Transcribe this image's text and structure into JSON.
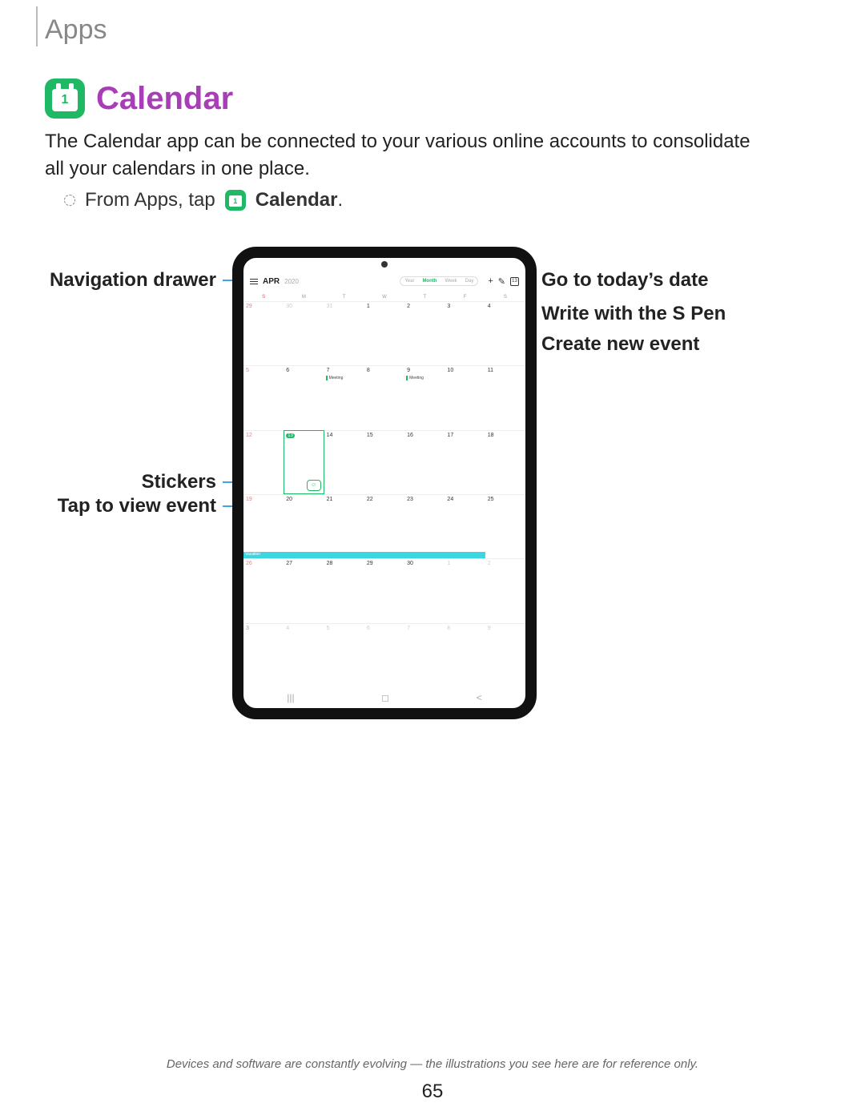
{
  "section": "Apps",
  "title": "Calendar",
  "icon_number": "1",
  "intro": "The Calendar app can be connected to your various online accounts to consolidate all your calendars in one place.",
  "step_prefix": "From Apps, tap",
  "step_app": "Calendar",
  "step_period": ".",
  "callouts": {
    "nav_drawer": "Navigation drawer",
    "today": "Go to today’s date",
    "spen": "Write with the S Pen",
    "new_event": "Create new event",
    "stickers": "Stickers",
    "tap_view": "Tap to view event"
  },
  "calendar": {
    "month": "APR",
    "year": "2020",
    "views": [
      "Year",
      "Month",
      "Week",
      "Day"
    ],
    "active_view": "Month",
    "today_box": "13",
    "dow": [
      "S",
      "M",
      "T",
      "W",
      "T",
      "F",
      "S"
    ],
    "rows": [
      [
        "29",
        "30",
        "31",
        "1",
        "2",
        "3",
        "4"
      ],
      [
        "5",
        "6",
        "7",
        "8",
        "9",
        "10",
        "11"
      ],
      [
        "12",
        "13",
        "14",
        "15",
        "16",
        "17",
        "18"
      ],
      [
        "19",
        "20",
        "21",
        "22",
        "23",
        "24",
        "25"
      ],
      [
        "26",
        "27",
        "28",
        "29",
        "30",
        "1",
        "2"
      ],
      [
        "3",
        "4",
        "5",
        "6",
        "7",
        "8",
        "9"
      ]
    ],
    "meeting_label": "Meeting",
    "event_label": "Vacation",
    "today_day": "13"
  },
  "footnote": "Devices and software are constantly evolving — the illustrations you see here are for reference only.",
  "page_number": "65"
}
